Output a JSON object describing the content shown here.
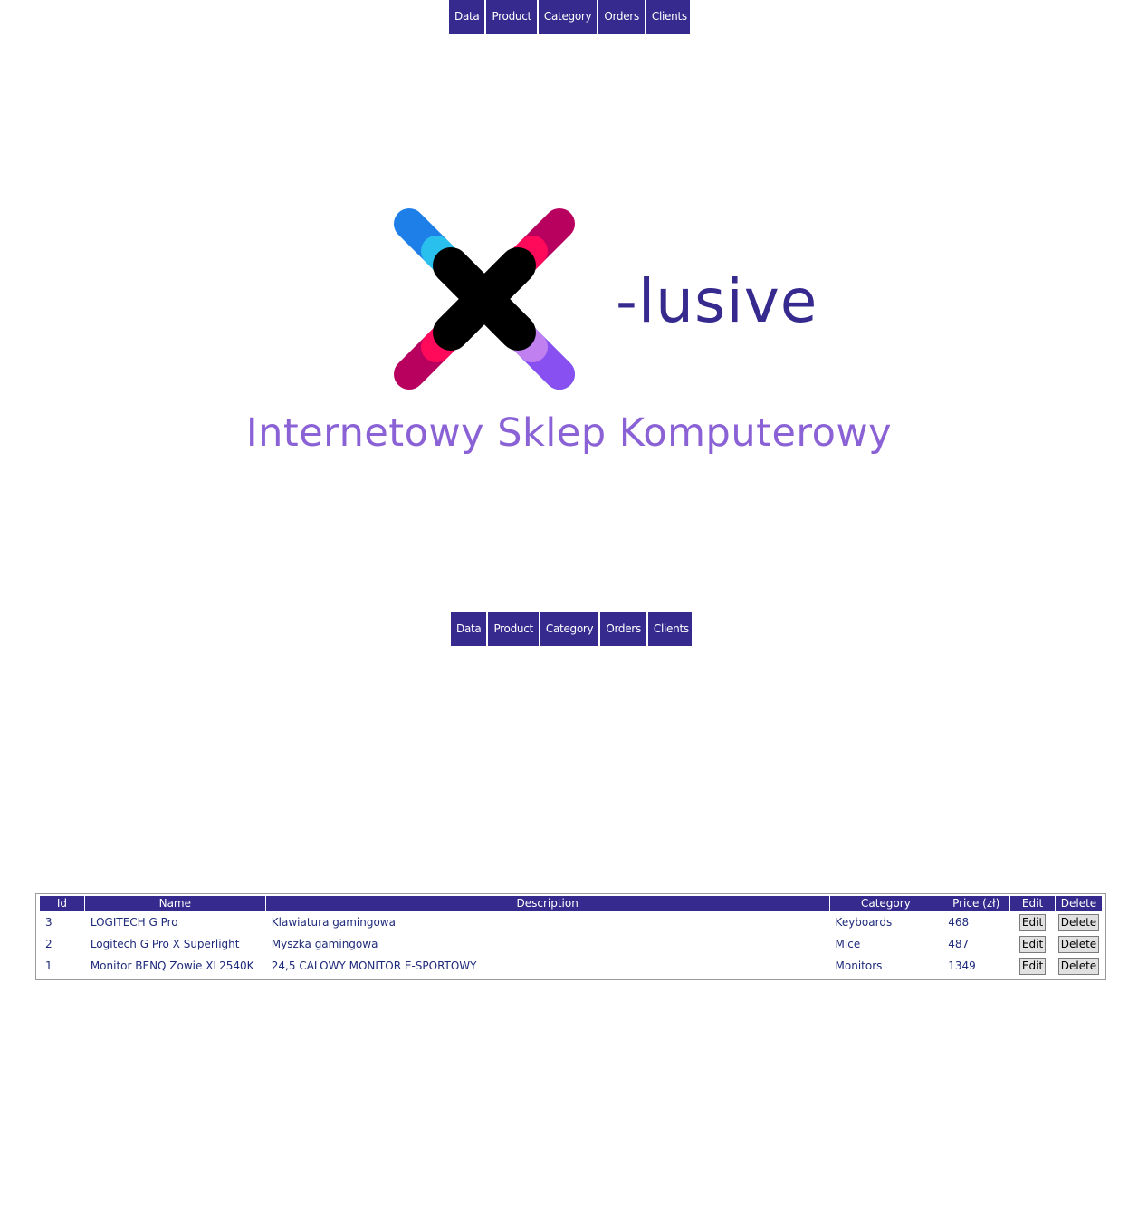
{
  "nav": {
    "items": [
      "Data",
      "Product",
      "Category",
      "Orders",
      "Clients"
    ]
  },
  "brand": {
    "word": "-lusive",
    "tagline": "Internetowy Sklep Komputerowy",
    "logo_icon": "x-logo-icon",
    "colors": {
      "primary": "#372a8e",
      "tagline": "#8a62d6",
      "blue": "#1e7fe8",
      "cyan": "#29c0ee",
      "magenta": "#b8005e",
      "pink": "#ff0a5a",
      "violet": "#8850f0",
      "lilac": "#c080f0"
    }
  },
  "table": {
    "headers": [
      "Id",
      "Name",
      "Description",
      "Category",
      "Price (zł)",
      "Edit",
      "Delete"
    ],
    "edit_label": "Edit",
    "delete_label": "Delete",
    "rows": [
      {
        "id": "3",
        "name": "LOGITECH G Pro",
        "description": "Klawiatura gamingowa",
        "category": "Keyboards",
        "price": "468"
      },
      {
        "id": "2",
        "name": "Logitech G Pro X Superlight",
        "description": "Myszka gamingowa",
        "category": "Mice",
        "price": "487"
      },
      {
        "id": "1",
        "name": "Monitor BENQ Zowie XL2540K",
        "description": "24,5 CALOWY MONITOR E-SPORTOWY",
        "category": "Monitors",
        "price": "1349"
      }
    ]
  }
}
